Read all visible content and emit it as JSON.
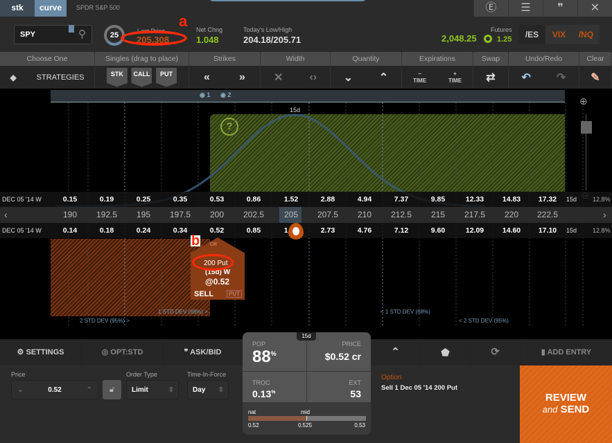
{
  "tabs": [
    {
      "label": "stk"
    },
    {
      "label": "curve"
    }
  ],
  "symbol_name": "SPDR S&P 500",
  "top_icons": [
    "earnings-icon",
    "list-icon",
    "quote-icon",
    "close-icon"
  ],
  "top_icon_glyphs": [
    "Ⓔ",
    "☰",
    "❞",
    "✕"
  ],
  "header": {
    "symbol": "SPY",
    "circle_value": "25",
    "last_price_label": "Last Price",
    "last_price": "205.308",
    "net_change_label": "Net Chng",
    "net_change": "1.048",
    "low_high_label": "Today's Low/High",
    "low_high": "204.18/205.71",
    "futures_label": "Futures",
    "futures_value": "2,048.25",
    "futures_change": "1.25",
    "futures_buttons": [
      "/ES",
      "VIX",
      "/NQ"
    ],
    "annotation_a": "a"
  },
  "colors": {
    "green": "#8fc31f",
    "orange": "#e06a1b",
    "red_anno": "#ff2a0a",
    "price_orange": "#c0540f"
  },
  "toolbar": {
    "headers": [
      "Choose One",
      "Singles (drag to place)",
      "Strikes",
      "Width",
      "Quantity",
      "Expirations",
      "Swap",
      "Undo/Redo",
      "Clear"
    ],
    "strategies": "STRATEGIES",
    "singles": [
      "STK",
      "CALL",
      "PUT"
    ],
    "minus_time": "TIME",
    "plus_time": "TIME"
  },
  "chart": {
    "markers": [
      "1",
      "2"
    ],
    "expiry_label": "15d",
    "upper_row": {
      "label": "DEC 05 '14 W",
      "values": [
        "0.15",
        "0.19",
        "0.25",
        "0.35",
        "0.53",
        "0.86",
        "1.52",
        "2.88",
        "4.94",
        "7.37",
        "9.85",
        "12.33",
        "14.83",
        "17.32"
      ],
      "days": "15d",
      "iv": "12.8%"
    },
    "strikes": [
      "190",
      "192.5",
      "195",
      "197.5",
      "200",
      "202.5",
      "205",
      "207.5",
      "210",
      "212.5",
      "215",
      "217.5",
      "220",
      "222.5"
    ],
    "lower_row": {
      "label": "DEC 05 '14 W",
      "values": [
        "0.14",
        "0.18",
        "0.24",
        "0.34",
        "0.52",
        "0.85",
        "1.50",
        "2.73",
        "4.76",
        "7.12",
        "9.60",
        "12.09",
        "14.60",
        "17.10"
      ],
      "days": "15d",
      "iv": "12.8%"
    },
    "std_labels": [
      "2 STD DEV (95%) >",
      "1 STD DEV (68%) >",
      "< 1 STD DEV (68%)",
      "< 2 STD DEV (95%)"
    ]
  },
  "order_tag": {
    "cr": "CR",
    "strike": "200 Put",
    "exp": "(15d) W",
    "price": "@0.52",
    "side": "SELL",
    "type": "PUT",
    "annotation_b": "b"
  },
  "bottom_toolbar": {
    "settings": "SETTINGS",
    "opt": "OPT:STD",
    "askbid": "ASK/BID",
    "add_entry": "ADD ENTRY"
  },
  "order": {
    "price_label": "Price",
    "price": "0.52",
    "order_type_label": "Order Type",
    "order_type": "Limit",
    "tif_label": "Time-In-Force",
    "tif": "Day",
    "section_label": "Option",
    "description": "Sell 1 Dec 05 '14 200 Put"
  },
  "stats": {
    "days": "15d",
    "pop_label": "POP",
    "pop": "88",
    "pop_unit": "%",
    "price_label": "PRICE",
    "price": "$0.52 cr",
    "troc_label": "TROC",
    "troc": "0.13",
    "troc_unit": "%",
    "ext_label": "EXT",
    "ext": "53",
    "nat_label": "nat",
    "mid_label": "mid",
    "nat": "0.52",
    "mid": "0.525",
    "far": "0.53"
  },
  "review": {
    "line1": "REVIEW",
    "and": "and",
    "send": "SEND"
  }
}
